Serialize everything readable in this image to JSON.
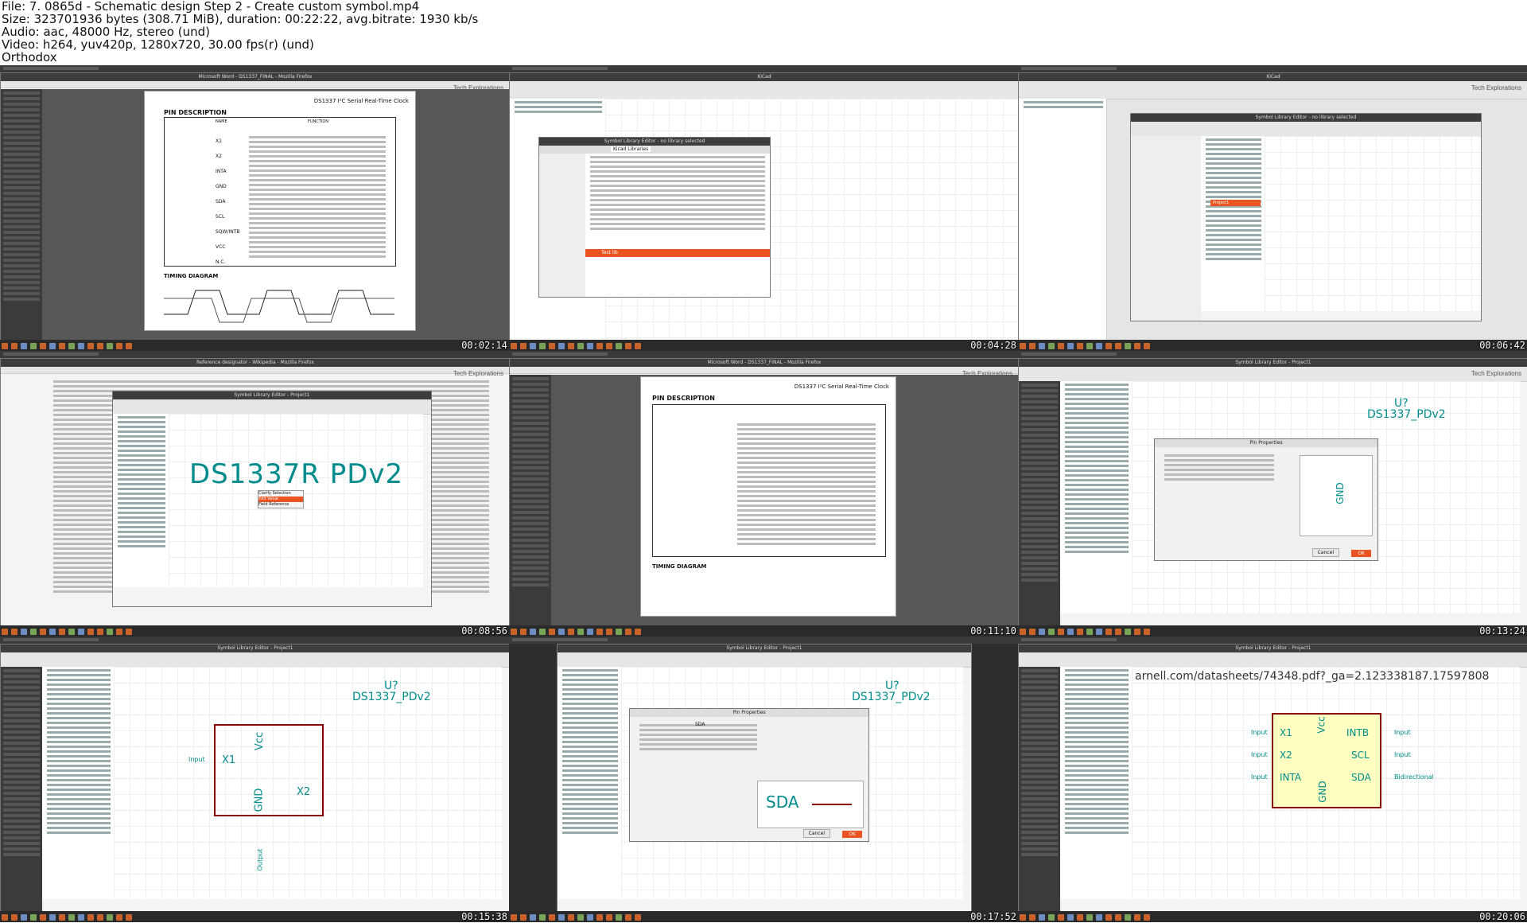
{
  "header": {
    "file_line": "File: 7. 0865d - Schematic design Step 2 - Create custom symbol.mp4",
    "size_line": "Size: 323701936 bytes (308.71 MiB), duration: 00:22:22, avg.bitrate: 1930 kb/s",
    "audio_line": "Audio: aac, 48000 Hz, stereo (und)",
    "video_line": "Video: h264, yuv420p, 1280x720, 30.00 fps(r) (und)",
    "distro_line": "Orthodox"
  },
  "thumbnails": [
    {
      "timestamp": "00:02:14"
    },
    {
      "timestamp": "00:04:28"
    },
    {
      "timestamp": "00:06:42"
    },
    {
      "timestamp": "00:08:56"
    },
    {
      "timestamp": "00:11:10"
    },
    {
      "timestamp": "00:13:24"
    },
    {
      "timestamp": "00:15:38"
    },
    {
      "timestamp": "00:17:52"
    },
    {
      "timestamp": "00:20:06"
    }
  ],
  "thumb1": {
    "doc_title": "DS1337 I²C Serial Real-Time Clock",
    "section": "PIN DESCRIPTION",
    "section2": "TIMING DIAGRAM",
    "col_name": "NAME",
    "col_function": "FUNCTION",
    "rows": [
      "X1",
      "X2",
      "INTA",
      "GND",
      "SDA",
      "SCL",
      "SQW/INTB",
      "VCC",
      "N.C."
    ]
  },
  "thumb2": {
    "dialog_title": "Symbol Library Editor - no library selected",
    "folder": "Kicad Libraries",
    "selected": "Test lib"
  },
  "thumb3": {
    "dialog_title": "Symbol Library Editor - no library selected",
    "selected": "Project1"
  },
  "thumb4": {
    "window_title": "Symbol Library Editor - Project1",
    "big_text": "DS1337R PDv2",
    "menu": [
      "Clarify Selection",
      "Edit Value",
      "Field Reference"
    ]
  },
  "thumb5": {
    "doc_title": "DS1337 I²C Serial Real-Time Clock",
    "section": "PIN DESCRIPTION",
    "section2": "TIMING DIAGRAM"
  },
  "thumb6": {
    "ref": "U?",
    "value": "DS1337_PDv2",
    "dialog_title": "Pin Properties",
    "pin_label": "GND",
    "ok": "OK",
    "cancel": "Cancel"
  },
  "thumb7": {
    "ref": "U?",
    "value": "DS1337_PDv2",
    "pins": {
      "x1": "X1",
      "x2": "X2",
      "vcc": "Vcc",
      "gnd": "GND",
      "input": "Input",
      "output": "Output"
    }
  },
  "thumb8": {
    "ref": "U?",
    "value": "DS1337_PDv2",
    "dialog_title": "Pin Properties",
    "pin_label": "SDA",
    "ok": "OK",
    "cancel": "Cancel"
  },
  "thumb9": {
    "url_text": "arnell.com/datasheets/74348.pdf?_ga=2.123338187.17597808",
    "pins": {
      "x1": "X1",
      "x2": "X2",
      "inta": "INTA",
      "intb": "INTB",
      "scl": "SCL",
      "sda": "SDA",
      "vcc": "Vcc",
      "gnd": "GND"
    },
    "labels": {
      "input": "Input",
      "bidirectional": "Bidirectional"
    }
  },
  "colors": {
    "symbol_fill": "#ffffc2",
    "symbol_line": "#8b0000",
    "pin_text": "#008c8c",
    "ubuntu_orange": "#e95420"
  }
}
